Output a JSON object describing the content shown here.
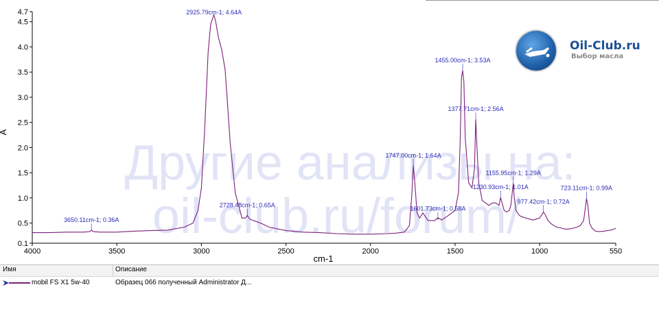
{
  "chart_data": {
    "type": "line",
    "xlabel": "cm-1",
    "ylabel": "A",
    "xlim": [
      4000,
      550
    ],
    "ylim": [
      0.1,
      4.7
    ],
    "x_ticks": [
      4000,
      3500,
      3000,
      2500,
      2000,
      1500,
      1000,
      550
    ],
    "x_tick_labels": [
      "4000",
      "3500",
      "3000",
      "2500",
      "2000",
      "1500",
      "1000",
      "550"
    ],
    "y_ticks": [
      0.1,
      0.5,
      1.0,
      1.5,
      2.0,
      2.5,
      3.0,
      3.5,
      4.0,
      4.5,
      4.7
    ],
    "y_tick_labels": [
      "0.1",
      "0.5",
      "1.0",
      "1.5",
      "2.0",
      "2.5",
      "3.0",
      "3.5",
      "4.0",
      "4.5",
      "4.7"
    ],
    "grid": false,
    "series": [
      {
        "name": "mobil FS X1 5w-40",
        "color": "#7a1f7a",
        "x": [
          4000,
          3900,
          3800,
          3700,
          3660,
          3650,
          3640,
          3600,
          3500,
          3400,
          3300,
          3200,
          3100,
          3050,
          3020,
          3000,
          2980,
          2960,
          2945,
          2935,
          2926,
          2915,
          2900,
          2880,
          2860,
          2850,
          2830,
          2800,
          2760,
          2740,
          2728,
          2715,
          2700,
          2650,
          2600,
          2500,
          2400,
          2300,
          2200,
          2100,
          2000,
          1900,
          1850,
          1800,
          1770,
          1755,
          1747,
          1738,
          1725,
          1710,
          1690,
          1660,
          1620,
          1605,
          1601,
          1597,
          1580,
          1540,
          1500,
          1480,
          1470,
          1462,
          1455,
          1448,
          1440,
          1420,
          1400,
          1385,
          1378,
          1372,
          1360,
          1340,
          1320,
          1300,
          1280,
          1260,
          1240,
          1231,
          1222,
          1210,
          1195,
          1180,
          1170,
          1162,
          1156,
          1150,
          1140,
          1120,
          1100,
          1080,
          1060,
          1040,
          1020,
          1000,
          990,
          977,
          965,
          950,
          930,
          900,
          870,
          850,
          830,
          800,
          780,
          760,
          740,
          730,
          723,
          715,
          705,
          690,
          670,
          650,
          620,
          600,
          580,
          560,
          550
        ],
        "y": [
          0.31,
          0.31,
          0.32,
          0.32,
          0.33,
          0.36,
          0.33,
          0.32,
          0.32,
          0.34,
          0.35,
          0.36,
          0.42,
          0.5,
          0.75,
          1.2,
          2.4,
          3.9,
          4.45,
          4.55,
          4.64,
          4.5,
          4.2,
          3.95,
          3.55,
          3.1,
          2.1,
          1.1,
          0.6,
          0.6,
          0.65,
          0.58,
          0.56,
          0.5,
          0.42,
          0.35,
          0.32,
          0.31,
          0.29,
          0.28,
          0.28,
          0.29,
          0.3,
          0.32,
          0.45,
          1.1,
          1.64,
          1.3,
          0.7,
          0.6,
          0.7,
          0.55,
          0.55,
          0.6,
          0.58,
          0.6,
          0.56,
          0.65,
          0.75,
          1.1,
          2.1,
          3.4,
          3.53,
          3.3,
          2.2,
          1.3,
          1.2,
          1.6,
          2.56,
          2.1,
          1.3,
          0.95,
          0.9,
          0.85,
          0.9,
          0.9,
          0.85,
          1.01,
          0.9,
          0.75,
          0.72,
          0.75,
          0.85,
          1.1,
          1.29,
          1.0,
          0.75,
          0.65,
          0.62,
          0.6,
          0.58,
          0.56,
          0.58,
          0.6,
          0.65,
          0.72,
          0.65,
          0.55,
          0.48,
          0.42,
          0.4,
          0.38,
          0.38,
          0.4,
          0.42,
          0.45,
          0.55,
          0.8,
          0.99,
          0.85,
          0.5,
          0.4,
          0.34,
          0.33,
          0.34,
          0.35,
          0.36,
          0.38,
          0.4
        ]
      }
    ],
    "annotations": [
      {
        "text": "3650.11cm-1; 0.36A",
        "x": 3650.11,
        "y": 0.36
      },
      {
        "text": "2925.79cm-1; 4.64A",
        "x": 2925.79,
        "y": 4.64
      },
      {
        "text": "2728.48cm-1; 0.65A",
        "x": 2728.48,
        "y": 0.65
      },
      {
        "text": "1747.00cm-1; 1.64A",
        "x": 1747.0,
        "y": 1.64
      },
      {
        "text": "1601.73cm-1; 0.58A",
        "x": 1601.73,
        "y": 0.58
      },
      {
        "text": "1455.00cm-1; 3.53A",
        "x": 1455.0,
        "y": 3.53
      },
      {
        "text": "1377.71cm-1; 2.56A",
        "x": 1377.71,
        "y": 2.56
      },
      {
        "text": "1230.93cm-1; 1.01A",
        "x": 1230.93,
        "y": 1.01
      },
      {
        "text": "1155.95cm-1; 1.29A",
        "x": 1155.95,
        "y": 1.29
      },
      {
        "text": "977.42cm-1; 0.72A",
        "x": 977.42,
        "y": 0.72
      },
      {
        "text": "723.11cm-1; 0.99A",
        "x": 723.11,
        "y": 0.99
      }
    ]
  },
  "watermark": {
    "line1": "Другие анализы на:",
    "line2": "oil-club.ru/forum/"
  },
  "logo": {
    "title": "Oil-Club.ru",
    "subtitle": "Выбор масла"
  },
  "legend_table": {
    "headers": [
      "Имя",
      "Описание"
    ],
    "rows": [
      {
        "name": "mobil FS X1 5w-40",
        "description": "Образец 066 полученный Administrator Д..."
      }
    ]
  }
}
